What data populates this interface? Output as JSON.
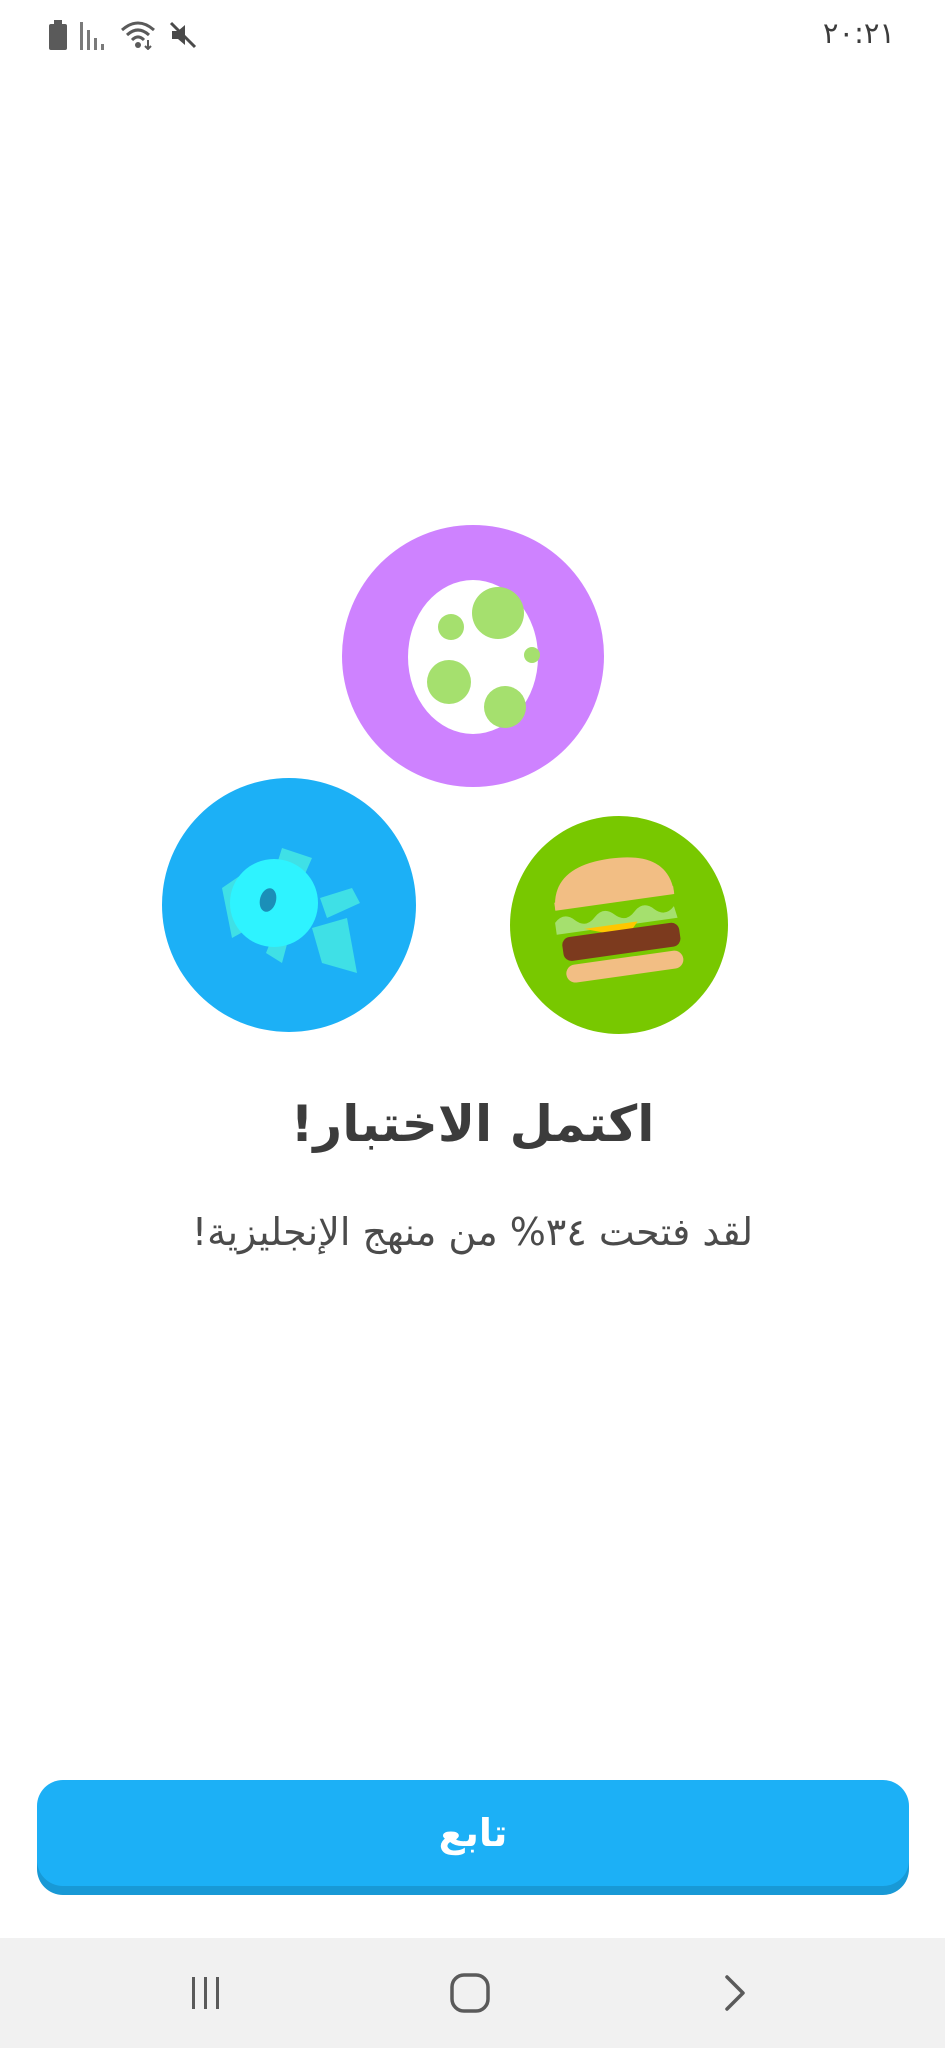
{
  "status_bar": {
    "time": "٢٠:٢١",
    "icons": [
      "battery-icon",
      "signal-icon",
      "wifi-icon",
      "mute-icon"
    ]
  },
  "illustrations": {
    "items": [
      "egg-badge",
      "candy-badge",
      "burger-badge"
    ],
    "colors": {
      "egg_bg": "#ce82ff",
      "candy_bg": "#1cb0f6",
      "burger_bg": "#78c800"
    }
  },
  "main": {
    "title": "اكتمل الاختبار!",
    "subtitle": "لقد فتحت ٣٤% من منهج الإنجليزية!"
  },
  "footer": {
    "continue_label": "تابع",
    "accent_color": "#1cb0f6"
  },
  "nav_bar": {
    "icons": [
      "recent-apps-icon",
      "home-icon",
      "back-icon"
    ]
  }
}
